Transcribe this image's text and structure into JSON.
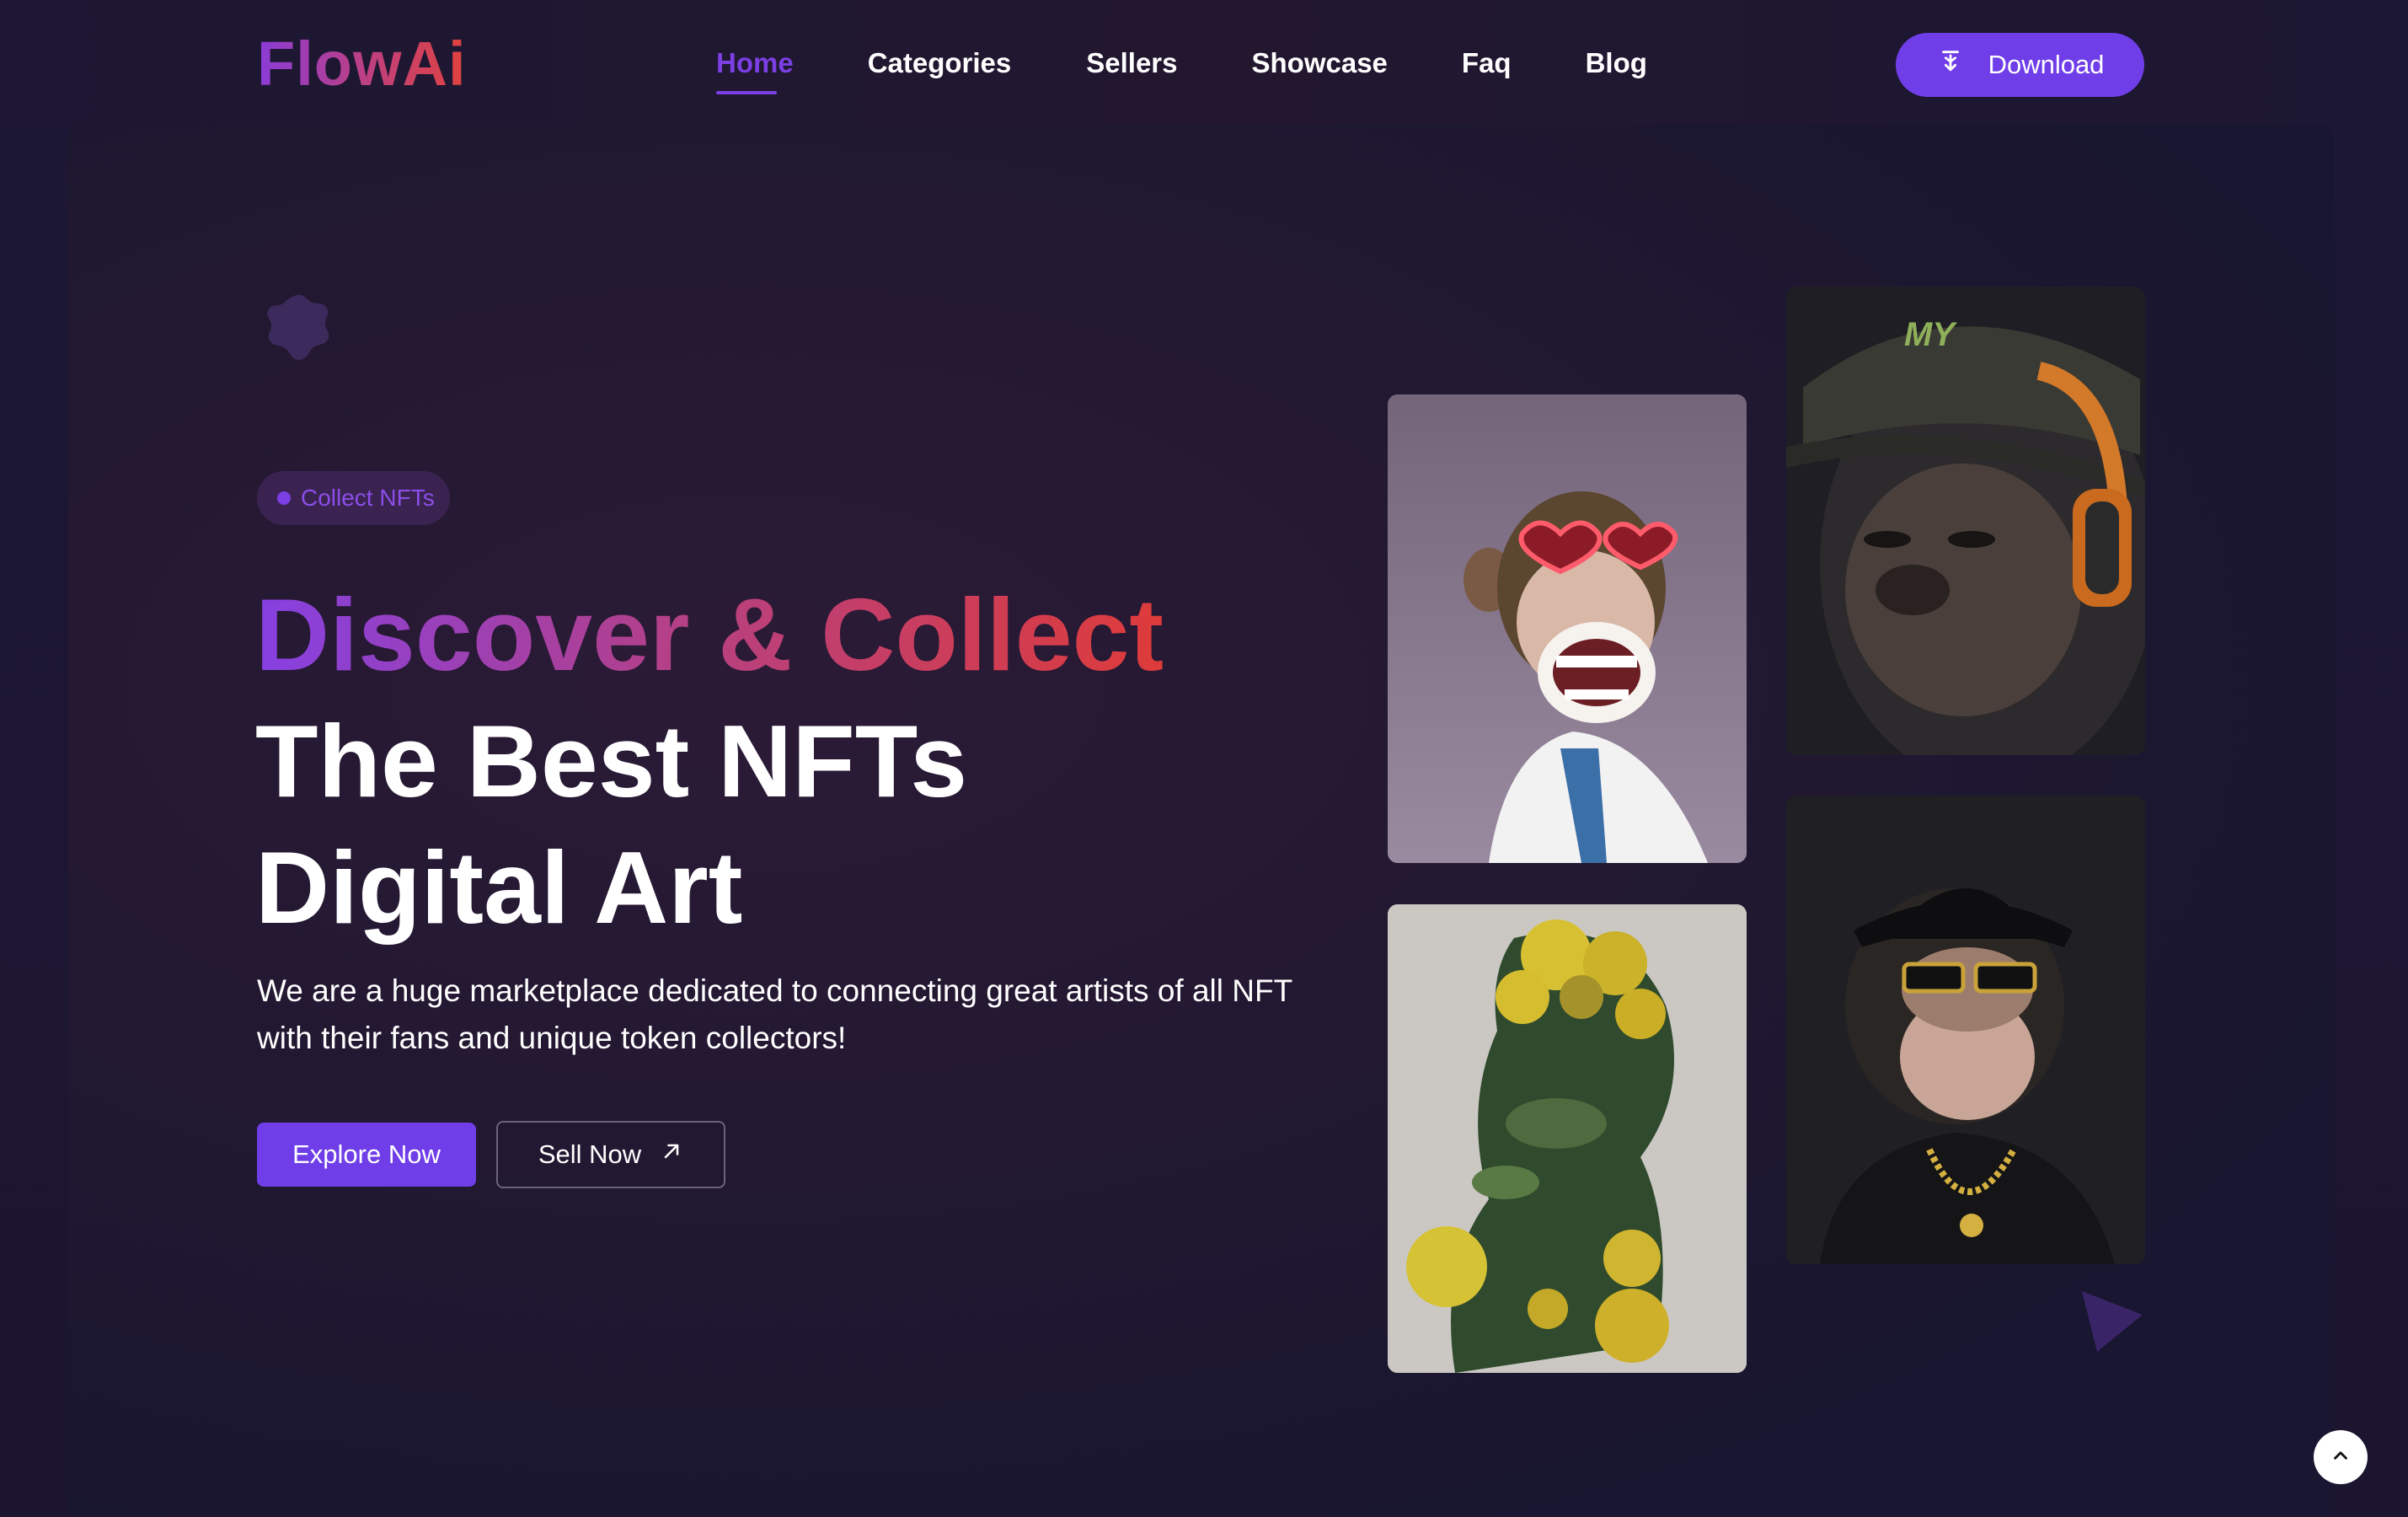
{
  "brand": {
    "logo_text": "FlowAi"
  },
  "nav": {
    "items": [
      {
        "label": "Home",
        "active": true
      },
      {
        "label": "Categories",
        "active": false
      },
      {
        "label": "Sellers",
        "active": false
      },
      {
        "label": "Showcase",
        "active": false
      },
      {
        "label": "Faq",
        "active": false
      },
      {
        "label": "Blog",
        "active": false
      }
    ],
    "download_label": "Download"
  },
  "hero": {
    "badge_label": "Collect NFTs",
    "heading_gradient": "Discover & Collect",
    "heading_main": "The Best NFTs Digital Art",
    "description": "We are a huge marketplace dedicated to connecting great artists of all NFT with their fans and unique token collectors!",
    "primary_button": "Explore Now",
    "secondary_button": "Sell Now"
  },
  "nft_cards": [
    {
      "name": "ape-heart-sunglasses",
      "icon": "ape-heart-glasses-image"
    },
    {
      "name": "gorilla-headphones",
      "icon": "gorilla-headphones-image"
    },
    {
      "name": "flower-portrait",
      "icon": "flower-portrait-image"
    },
    {
      "name": "ape-black-hat",
      "icon": "ape-hat-chain-image"
    }
  ],
  "colors": {
    "accent": "#6f3ee8",
    "gradient_start": "#8640e2",
    "gradient_end": "#de3b3a",
    "background": "#1b1734"
  },
  "scroll_top_icon": "chevron-up-icon"
}
